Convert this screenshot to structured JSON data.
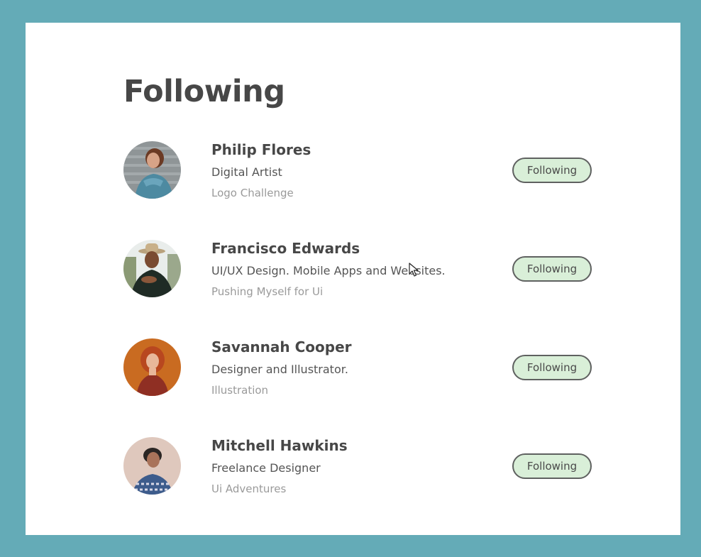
{
  "page": {
    "title": "Following"
  },
  "users": [
    {
      "name": "Philip Flores",
      "description": "Digital Artist",
      "tag": "Logo Challenge",
      "button_label": "Following"
    },
    {
      "name": "Francisco Edwards",
      "description": "UI/UX Design. Mobile Apps and Websites.",
      "tag": "Pushing Myself for Ui",
      "button_label": "Following"
    },
    {
      "name": "Savannah Cooper",
      "description": "Designer and Illustrator.",
      "tag": "Illustration",
      "button_label": "Following"
    },
    {
      "name": "Mitchell Hawkins",
      "description": "Freelance Designer",
      "tag": "Ui Adventures",
      "button_label": "Following"
    }
  ],
  "colors": {
    "frame_background": "#64abb7",
    "card_background": "#ffffff",
    "button_fill": "#d9efd8",
    "button_border": "#5f6160",
    "title_text": "#474747",
    "tag_text": "#9a9a9a"
  },
  "icons": {
    "cursor": "mouse-pointer-icon"
  }
}
